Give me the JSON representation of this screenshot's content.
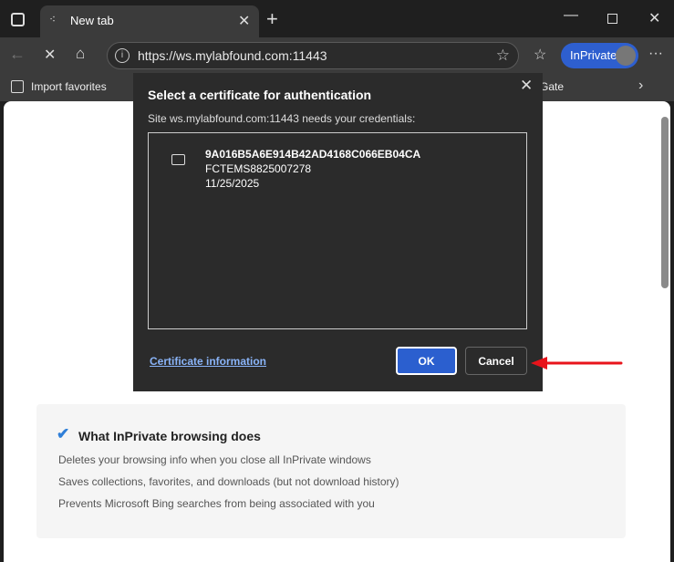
{
  "browser": {
    "tab_title": "New tab",
    "url": "https://ws.mylabfound.com:11443",
    "inprivate_label": "InPrivate",
    "favorites": {
      "import": "Import favorites",
      "partial_item": "Gate"
    }
  },
  "dialog": {
    "title": "Select a certificate for authentication",
    "subtitle": "Site ws.mylabfound.com:11443 needs your credentials:",
    "certificates": [
      {
        "id": "9A016B5A6E914B42AD4168C066EB04CA",
        "name": "FCTEMS8825007278",
        "date": "11/25/2025"
      }
    ],
    "cert_info_link": "Certificate information",
    "ok_label": "OK",
    "cancel_label": "Cancel"
  },
  "inprivate_card": {
    "title": "What InPrivate browsing does",
    "items": [
      "Deletes your browsing info when you close all InPrivate windows",
      "Saves collections, favorites, and downloads (but not download history)",
      "Prevents Microsoft Bing searches from being associated with you"
    ]
  },
  "annotation": {
    "arrow_color": "#e8141b"
  }
}
